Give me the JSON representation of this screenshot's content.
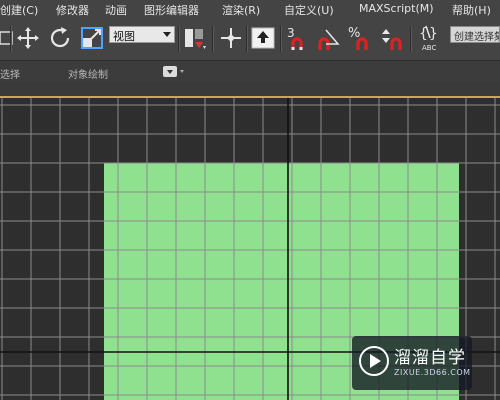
{
  "menu": {
    "items": [
      "创建(C)",
      "修改器",
      "动画",
      "图形编辑器",
      "渲染(R)",
      "自定义(U)",
      "MAXScript(M)",
      "帮助(H)"
    ]
  },
  "toolbar": {
    "view_dropdown_value": "视图",
    "selection_set_value": "创建选择集",
    "snap_label": "3",
    "percent_label": "%",
    "abc_label": "ABC"
  },
  "ribbon": {
    "select_label": "选择",
    "object_paint_label": "对象绘制"
  },
  "viewport": {
    "grid_color": "#8c8c8c",
    "grid_bg": "#2e2e2e",
    "axis_color": "#111111",
    "plane_color": "#8fe08f"
  },
  "watermark": {
    "title": "溜溜自学",
    "subtitle": "ZIXUE.3D66.COM"
  }
}
